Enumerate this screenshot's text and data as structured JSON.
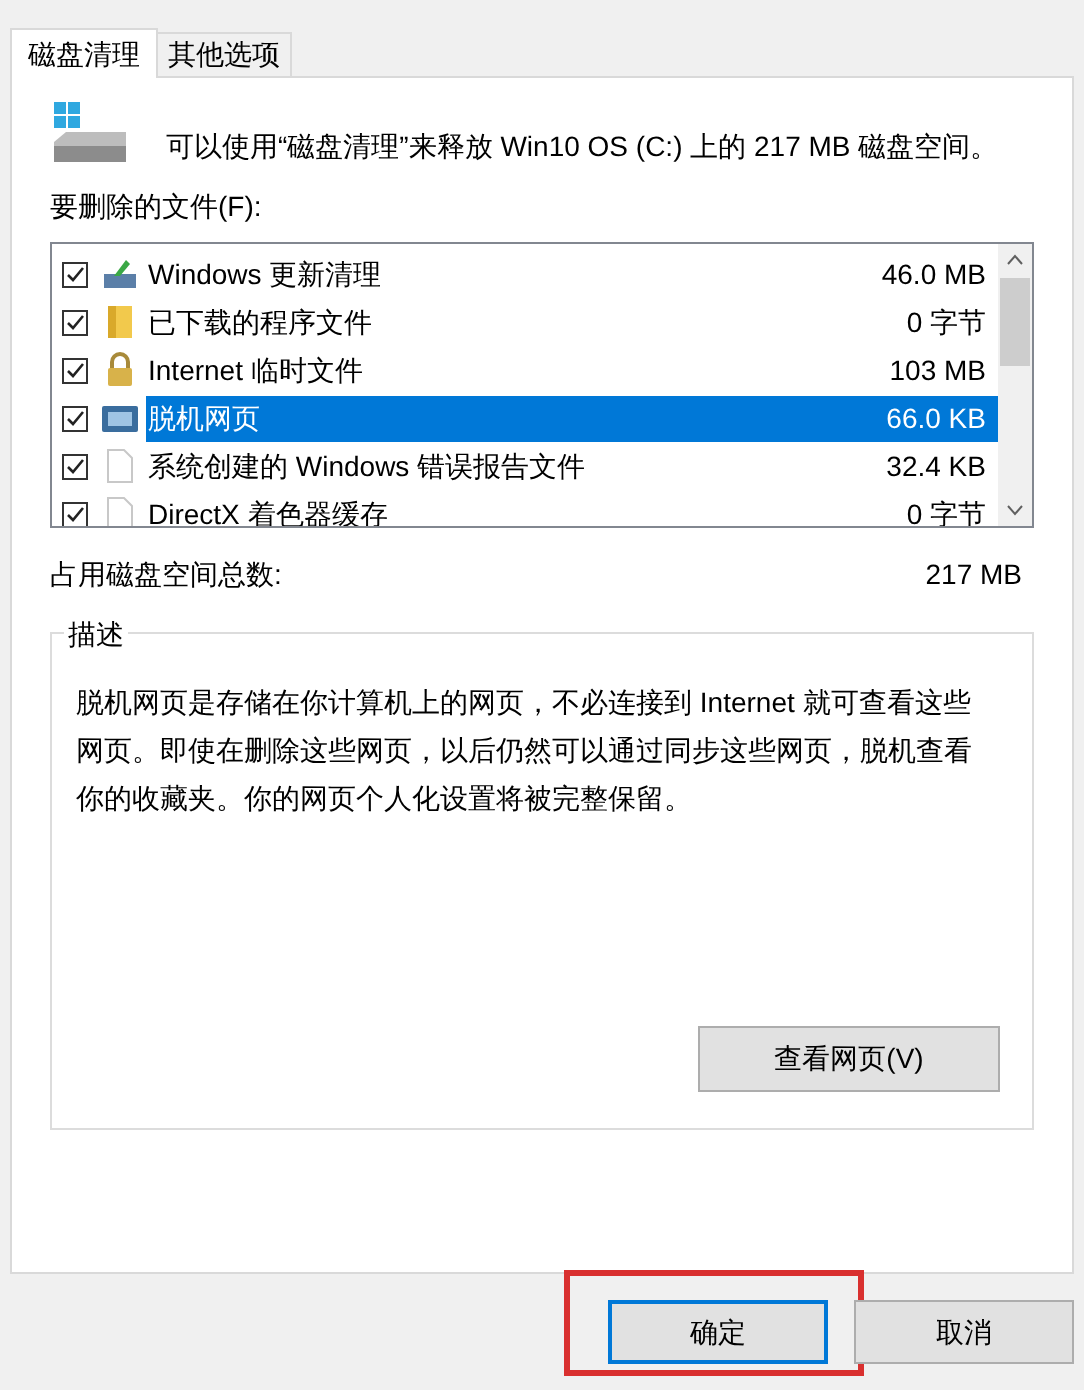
{
  "tabs": [
    {
      "label": "磁盘清理",
      "selected": true
    },
    {
      "label": "其他选项",
      "selected": false
    }
  ],
  "intro": "可以使用“磁盘清理”来释放 Win10 OS (C:) 上的 217 MB 磁盘空间。",
  "files_label": "要删除的文件(F):",
  "files": [
    {
      "kind": "update",
      "name": "Windows 更新清理",
      "size": "46.0 MB",
      "checked": true,
      "selected": false
    },
    {
      "kind": "folder",
      "name": "已下载的程序文件",
      "size": "0 字节",
      "checked": true,
      "selected": false
    },
    {
      "kind": "lock",
      "name": "Internet 临时文件",
      "size": "103 MB",
      "checked": true,
      "selected": false
    },
    {
      "kind": "web",
      "name": "脱机网页",
      "size": "66.0 KB",
      "checked": true,
      "selected": true
    },
    {
      "kind": "file",
      "name": "系统创建的 Windows 错误报告文件",
      "size": "32.4 KB",
      "checked": true,
      "selected": false
    },
    {
      "kind": "file",
      "name": "DirectX 着色器缓存",
      "size": "0 字节",
      "checked": true,
      "selected": false
    }
  ],
  "total": {
    "label": "占用磁盘空间总数:",
    "value": "217 MB"
  },
  "description": {
    "title": "描述",
    "text": "脱机网页是存储在你计算机上的网页，不必连接到 Internet 就可查看这些网页。即使在删除这些网页，以后仍然可以通过同步这些网页，脱机查看你的收藏夹。你的网页个人化设置将被完整保留。",
    "button": "查看网页(V)"
  },
  "buttons": [
    {
      "label": "确定",
      "default": true,
      "highlighted": true
    },
    {
      "label": "取消",
      "default": false,
      "highlighted": false
    }
  ]
}
